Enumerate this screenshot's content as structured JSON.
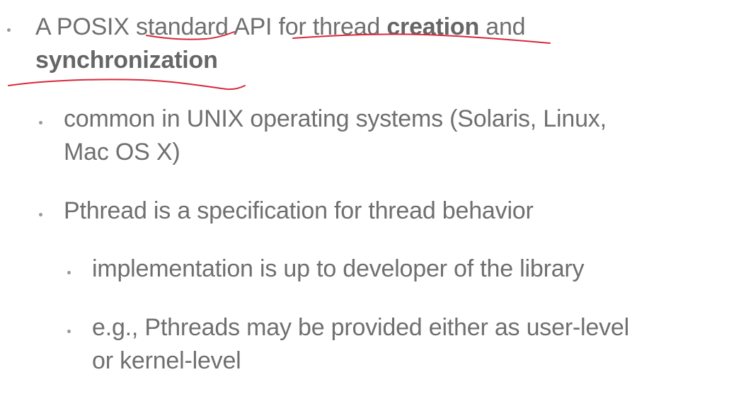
{
  "bullets": {
    "b1": {
      "prefix": "A POSIX standard API for thread ",
      "bold1": "creation",
      "middle": " and",
      "bold2": "synchronization"
    },
    "b2": {
      "line1": "common in UNIX operating systems (Solaris, Linux,",
      "line2": "Mac OS X)"
    },
    "b3": {
      "line1": "Pthread is a specification for thread behavior"
    },
    "b4": {
      "line1": "implementation is up to developer of the library"
    },
    "b5": {
      "line1": "e.g., Pthreads may be provided either as user-level",
      "line2": "or kernel-level"
    }
  },
  "annotation": {
    "ink_color": "#d8283a"
  }
}
